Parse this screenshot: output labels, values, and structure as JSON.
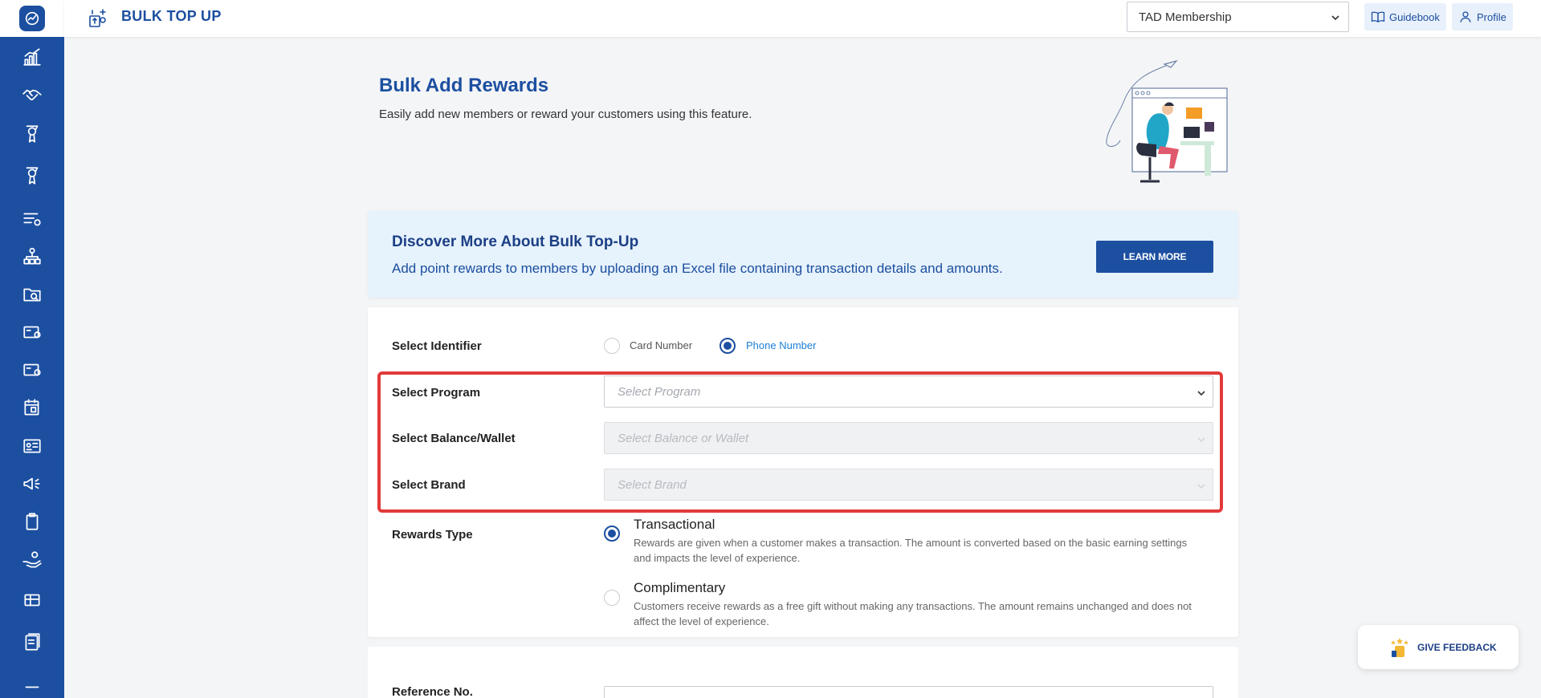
{
  "header": {
    "title": "BULK TOP UP",
    "membership_value": "TAD Membership",
    "guidebook_label": "Guidebook",
    "profile_label": "Profile"
  },
  "sidebar": {
    "icons": [
      "chart-icon",
      "handshake-icon",
      "trophy-icon",
      "medal-icon",
      "list-settings-icon",
      "hierarchy-icon",
      "folder-search-icon",
      "card-icon",
      "card-settings-icon",
      "calendar-icon",
      "id-card-icon",
      "megaphone-icon",
      "clipboard-icon",
      "hand-coins-icon",
      "gift-card-icon",
      "document-icon"
    ]
  },
  "intro": {
    "title": "Bulk Add Rewards",
    "subtitle": "Easily add new members or reward your customers using this feature."
  },
  "banner": {
    "title": "Discover More About Bulk Top-Up",
    "subtitle": "Add point rewards to members by uploading an Excel file containing transaction details and amounts.",
    "button_label": "LEARN MORE"
  },
  "form": {
    "identifier_label": "Select Identifier",
    "identifier_options": [
      "Card Number",
      "Phone Number"
    ],
    "identifier_selected": "Phone Number",
    "program_label": "Select Program",
    "program_placeholder": "Select Program",
    "wallet_label": "Select Balance/Wallet",
    "wallet_placeholder": "Select Balance or Wallet",
    "brand_label": "Select Brand",
    "brand_placeholder": "Select Brand",
    "rewards_type_label": "Rewards Type",
    "rewards_types": [
      {
        "title": "Transactional",
        "desc": "Rewards are given when a customer makes a transaction. The amount is converted based on the basic earning settings and impacts the level of experience."
      },
      {
        "title": "Complimentary",
        "desc": "Customers receive rewards as a free gift without making any transactions. The amount remains unchanged and does not affect the level of experience."
      }
    ],
    "rewards_selected": "Transactional",
    "reference_label": "Reference No."
  },
  "feedback": {
    "label": "GIVE FEEDBACK"
  },
  "colors": {
    "primary": "#1c4fa0",
    "highlight": "#e23a3a",
    "banner_bg": "#e6f2fc",
    "link_blue": "#1c7fd6"
  }
}
